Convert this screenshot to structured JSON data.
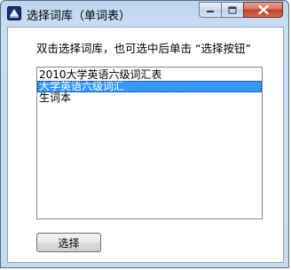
{
  "window": {
    "title": "选择词库（单词表）"
  },
  "main": {
    "instruction": "双击选择词库，也可选中后单击 “选择按钮”",
    "list_items": [
      {
        "label": "2010大学英语六级词汇表",
        "selected": false
      },
      {
        "label": "大学英语六级词汇",
        "selected": true
      },
      {
        "label": "生词本",
        "selected": false
      }
    ],
    "select_button_label": "选择"
  },
  "colors": {
    "selection": "#3399ff",
    "close_button": "#c2402b",
    "titlebar": "#bcd6ee"
  },
  "icons": [
    "app-icon",
    "minimize-icon",
    "maximize-icon",
    "close-icon"
  ]
}
